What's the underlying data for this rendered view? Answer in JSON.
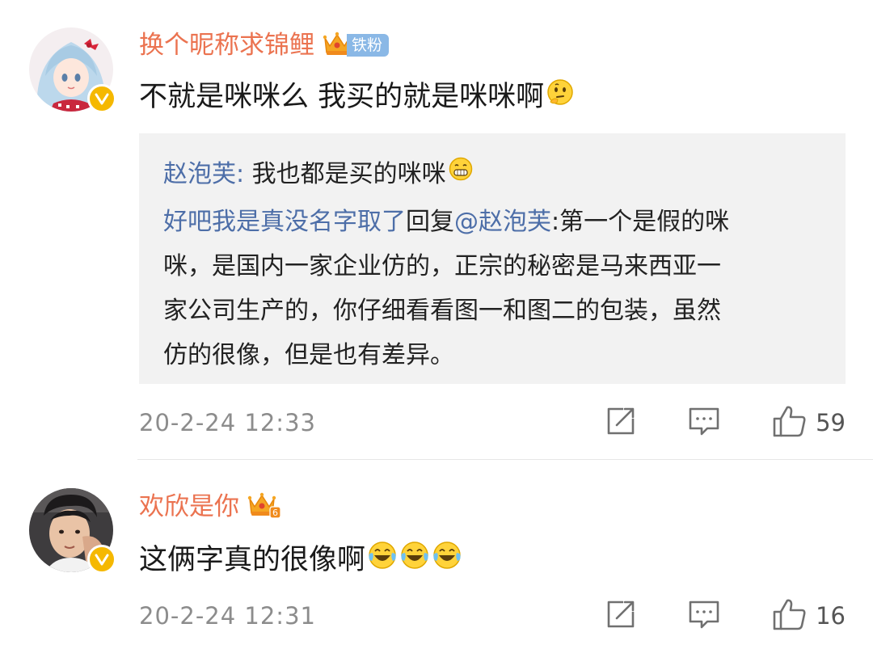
{
  "comments": [
    {
      "username": "换个昵称求锦鲤",
      "fan_badge": "铁粉",
      "content": "不就是咪咪么 我买的就是咪咪啊",
      "content_emoji": "thinking-emoji",
      "reply_box": {
        "reply1_author": "赵泡芙",
        "reply1_sep": ": ",
        "reply1_text": "我也都是买的咪咪",
        "reply1_emoji": "grin-emoji",
        "reply2_author": "好吧我是真没名字取了",
        "reply2_mid": "回复",
        "reply2_mention": "@赵泡芙",
        "reply2_lines": [
          ":第一个是假的咪",
          "咪，是国内一家企业仿的，正宗的秘密是马来西亚一",
          "家公司生产的，你仔细看看图一和图二的包装，虽然",
          "仿的很像，但是也有差异。"
        ]
      },
      "timestamp": "20-2-24 12:33",
      "like_count": "59"
    },
    {
      "username": "欢欣是你",
      "content": "这俩字真的很像啊",
      "content_emoji": "laugh-cry-emoji",
      "timestamp": "20-2-24 12:31",
      "like_count": "16"
    }
  ],
  "colors": {
    "username": "#eb7350",
    "link_blue": "#4d6ea8",
    "meta_gray": "#8c8c8c",
    "reply_bg": "#f2f2f2",
    "verified_badge": "#f5b800",
    "fan_badge": "#8ab8e6"
  },
  "icons": [
    "share-icon",
    "comment-icon",
    "like-icon",
    "crown-icon",
    "verified-icon"
  ]
}
